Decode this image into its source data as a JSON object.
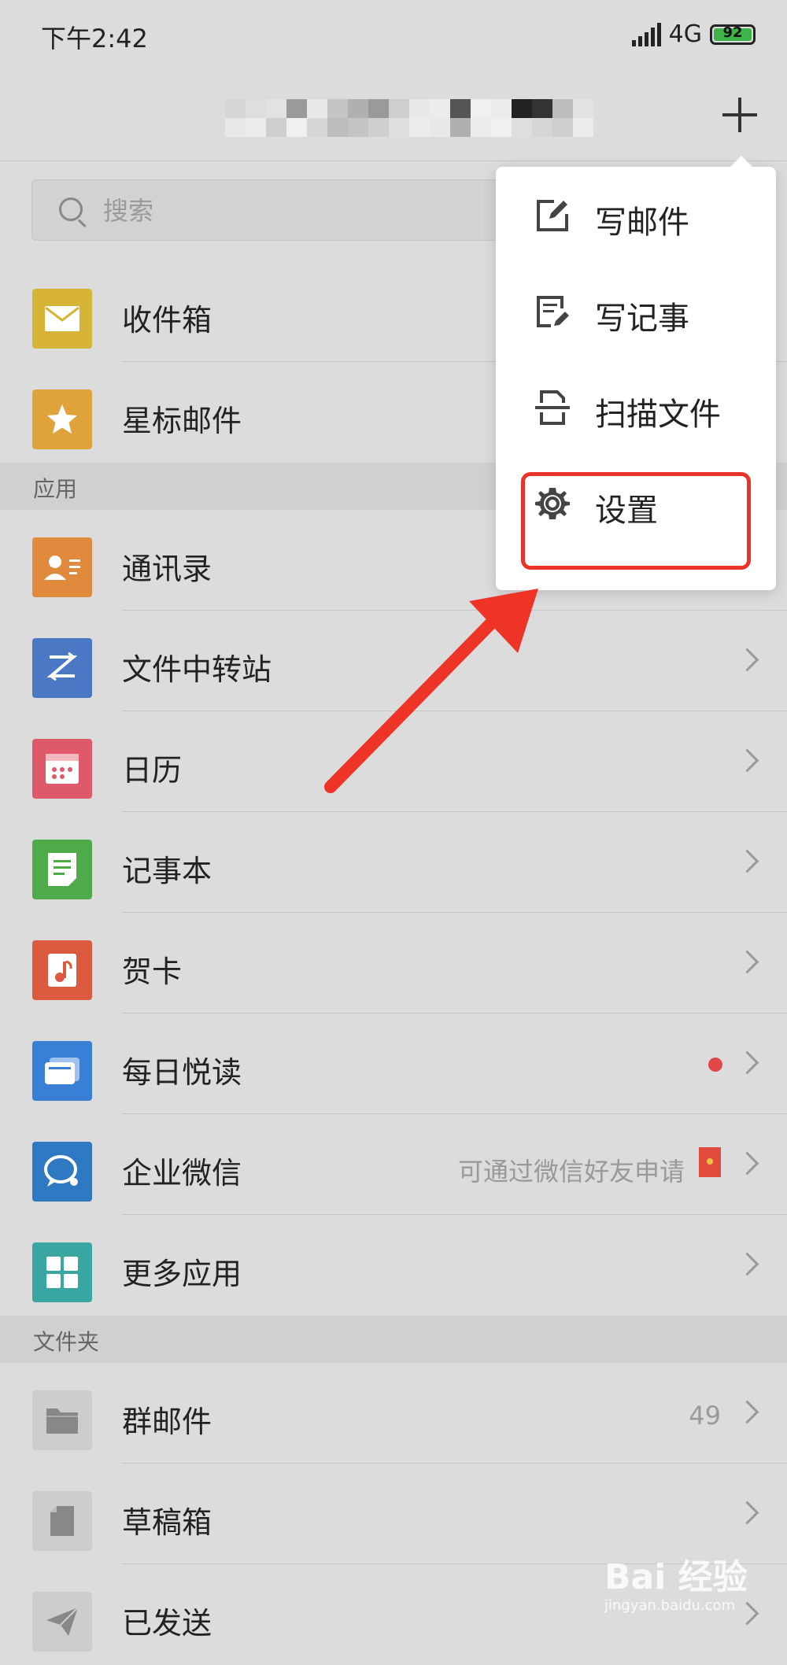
{
  "status_bar": {
    "time": "下午2:42",
    "network": "4G",
    "battery": "92"
  },
  "header": {
    "title_obscured": true
  },
  "search": {
    "placeholder": "搜索"
  },
  "mail": [
    {
      "label": "收件箱",
      "icon": "inbox-icon",
      "color": "#d8b436"
    },
    {
      "label": "星标邮件",
      "icon": "star-icon",
      "color": "#e0a33b"
    }
  ],
  "apps_section": {
    "title": "应用"
  },
  "apps": [
    {
      "label": "通讯录",
      "icon": "contacts-icon",
      "color": "#e08a3e"
    },
    {
      "label": "文件中转站",
      "icon": "transfer-icon",
      "color": "#4a78c4"
    },
    {
      "label": "日历",
      "icon": "calendar-icon",
      "color": "#de5a6a"
    },
    {
      "label": "记事本",
      "icon": "notes-icon",
      "color": "#4faa49"
    },
    {
      "label": "贺卡",
      "icon": "card-icon",
      "color": "#dc5a40"
    },
    {
      "label": "每日悦读",
      "icon": "reader-icon",
      "color": "#3a7fd6"
    },
    {
      "label": "企业微信",
      "icon": "wecom-icon",
      "color": "#2f78c2",
      "note": "可通过微信好友申请"
    },
    {
      "label": "更多应用",
      "icon": "more-apps-icon",
      "color": "#3aa6a2"
    }
  ],
  "folders_section": {
    "title": "文件夹"
  },
  "folders": [
    {
      "label": "群邮件",
      "icon": "folder-icon",
      "count": "49"
    },
    {
      "label": "草稿箱",
      "icon": "draft-icon"
    },
    {
      "label": "已发送",
      "icon": "sent-icon"
    }
  ],
  "popup": {
    "items": [
      {
        "label": "写邮件",
        "icon": "compose-icon"
      },
      {
        "label": "写记事",
        "icon": "write-note-icon"
      },
      {
        "label": "扫描文件",
        "icon": "scan-icon"
      },
      {
        "label": "设置",
        "icon": "settings-icon"
      }
    ]
  },
  "watermark": {
    "brand": "Bai 经验",
    "url": "jingyan.baidu.com"
  },
  "colors": {
    "highlight": "#e8322a",
    "arrow": "#ee3327"
  }
}
